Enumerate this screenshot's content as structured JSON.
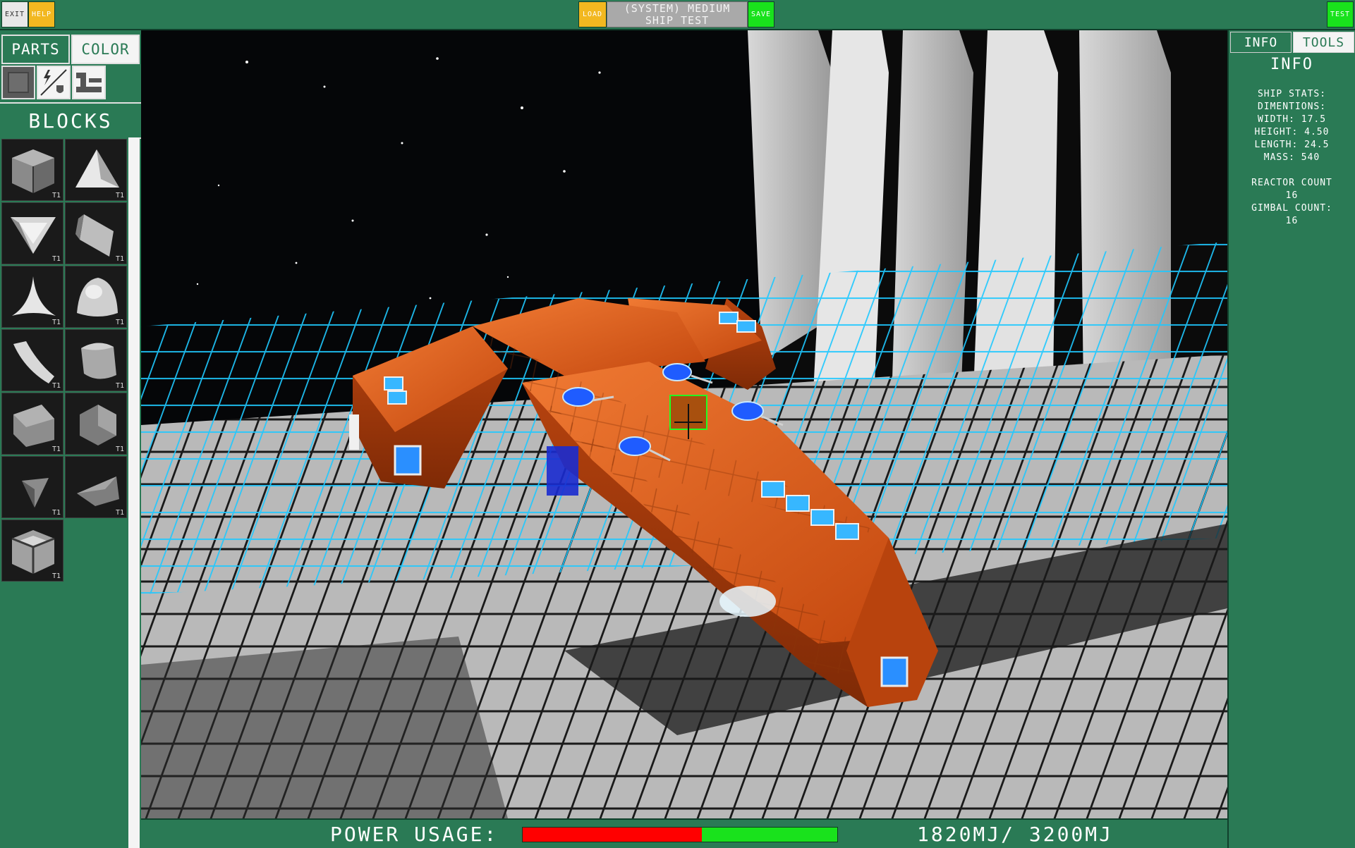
{
  "topbar": {
    "exit_label": "EXIT",
    "help_label": "HELP",
    "load_label": "LOAD",
    "title_line1": "(SYSTEM) MEDIUM",
    "title_line2": "SHIP TEST",
    "save_label": "SAVE",
    "test_label": "TEST"
  },
  "left": {
    "tabs": {
      "parts": "PARTS",
      "color": "COLOR"
    },
    "categories": [
      "cube-block-icon",
      "systems-icon",
      "structure-icon"
    ],
    "section_title": "BLOCKS",
    "parts": [
      {
        "shape": "cube",
        "tier": "T1"
      },
      {
        "shape": "tetra",
        "tier": "T1"
      },
      {
        "shape": "inverted-corner",
        "tier": "T1"
      },
      {
        "shape": "slope",
        "tier": "T1"
      },
      {
        "shape": "spike",
        "tier": "T1"
      },
      {
        "shape": "dome",
        "tier": "T1"
      },
      {
        "shape": "curve-wedge",
        "tier": "T1"
      },
      {
        "shape": "curve-slope",
        "tier": "T1"
      },
      {
        "shape": "box-slope",
        "tier": "T1"
      },
      {
        "shape": "bevel-box",
        "tier": "T1"
      },
      {
        "shape": "pyramid-corner",
        "tier": "T1"
      },
      {
        "shape": "flat-wedge",
        "tier": "T1"
      },
      {
        "shape": "frame-cube",
        "tier": "T1"
      }
    ]
  },
  "right": {
    "tabs": {
      "info": "INFO",
      "tools": "TOOLS"
    },
    "heading": "INFO",
    "stats": {
      "title": "SHIP STATS:",
      "dimensions": "DIMENTIONS:",
      "width": "WIDTH: 17.5",
      "height": "HEIGHT: 4.50",
      "length": "LENGTH: 24.5",
      "mass": "MASS: 540",
      "reactor_label": "REACTOR COUNT",
      "reactor_value": "16",
      "gimbal_label": "GIMBAL COUNT:",
      "gimbal_value": "16"
    }
  },
  "bottom": {
    "power_label": "POWER USAGE:",
    "power_used": 1820,
    "power_max": 3200,
    "power_readout": "1820MJ/ 3200MJ",
    "colors": {
      "used": "#ff0000",
      "free": "#19e21c"
    }
  },
  "colors": {
    "panel": "#2a7a55",
    "hull": "#d9561b",
    "accent_grid": "#1ec8ff"
  }
}
